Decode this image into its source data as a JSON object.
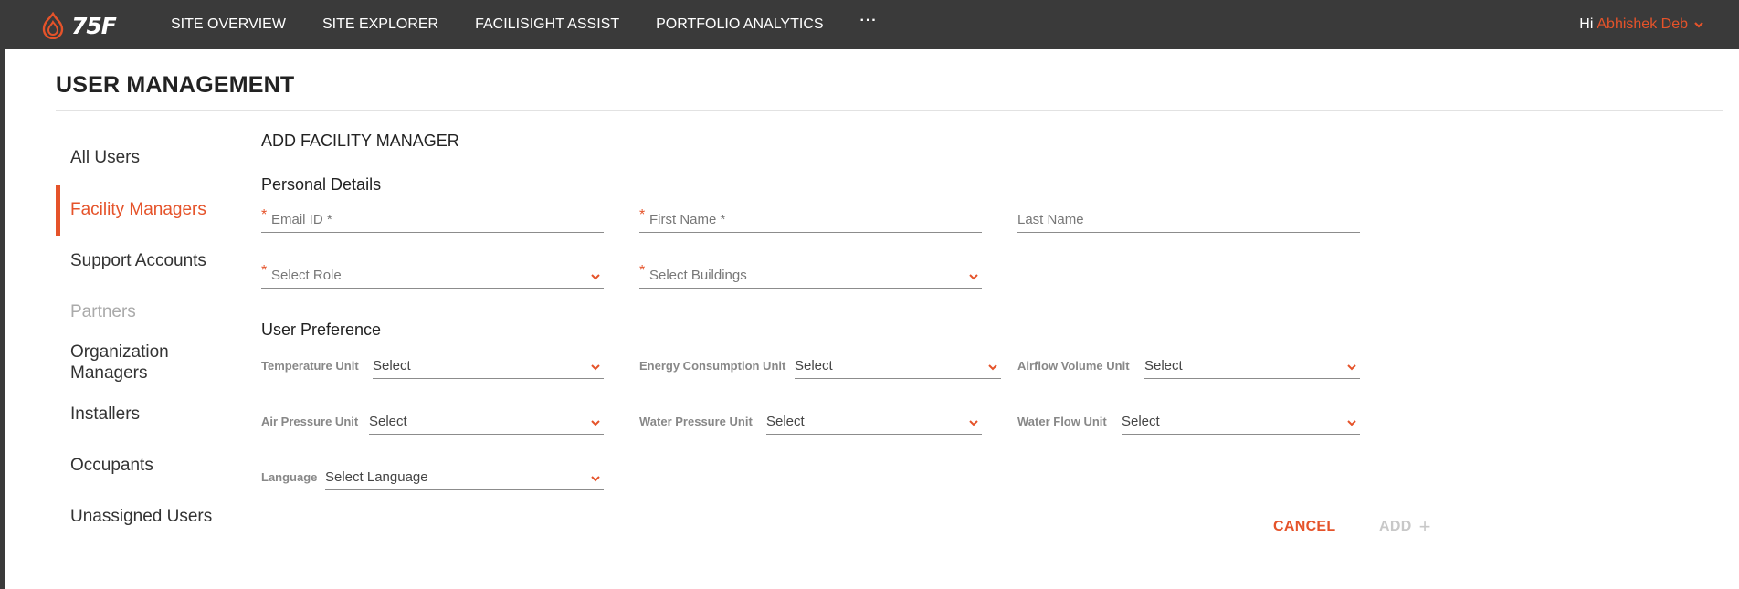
{
  "header": {
    "logo_text": "75F",
    "nav": [
      "SITE OVERVIEW",
      "SITE EXPLORER",
      "FACILISIGHT ASSIST",
      "PORTFOLIO ANALYTICS"
    ],
    "more": "···",
    "greeting": "Hi",
    "user_name": "Abhishek Deb"
  },
  "page": {
    "title": "USER MANAGEMENT"
  },
  "sidebar": {
    "items": [
      {
        "label": "All Users"
      },
      {
        "label": "Facility Managers"
      },
      {
        "label": "Support Accounts"
      },
      {
        "label": "Partners"
      },
      {
        "label": "Organization Managers"
      },
      {
        "label": "Installers"
      },
      {
        "label": "Occupants"
      },
      {
        "label": "Unassigned Users"
      }
    ]
  },
  "form": {
    "title": "ADD FACILITY MANAGER",
    "personal_heading": "Personal Details",
    "email_placeholder": "Email ID *",
    "first_name_placeholder": "First Name *",
    "last_name_placeholder": "Last Name",
    "role_placeholder": "Select Role",
    "buildings_placeholder": "Select Buildings",
    "required_mark": "*",
    "preference_heading": "User Preference",
    "prefs": {
      "temperature": {
        "label": "Temperature Unit",
        "value": "Select"
      },
      "energy": {
        "label": "Energy Consumption Unit",
        "value": "Select"
      },
      "airflow": {
        "label": "Airflow Volume Unit",
        "value": "Select"
      },
      "air_pressure": {
        "label": "Air Pressure Unit",
        "value": "Select"
      },
      "water_pressure": {
        "label": "Water Pressure Unit",
        "value": "Select"
      },
      "water_flow": {
        "label": "Water Flow Unit",
        "value": "Select"
      },
      "language": {
        "label": "Language",
        "value": "Select Language"
      }
    },
    "cancel_label": "CANCEL",
    "add_label": "ADD",
    "add_icon": "+"
  },
  "colors": {
    "accent": "#e5532a",
    "topbar": "#3a3a3a",
    "disabled": "#c8c8c8"
  }
}
